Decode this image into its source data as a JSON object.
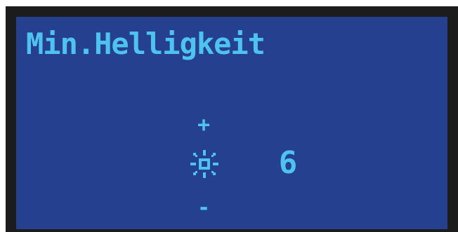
{
  "screen": {
    "title": "Min.Helligkeit"
  },
  "adjuster": {
    "increase_label": "+",
    "decrease_label": "-",
    "icon": "sun-brightness-icon",
    "value": "6"
  },
  "colors": {
    "background": "#24408e",
    "text": "#4fc3f0",
    "bezel": "#1c1c1c"
  }
}
